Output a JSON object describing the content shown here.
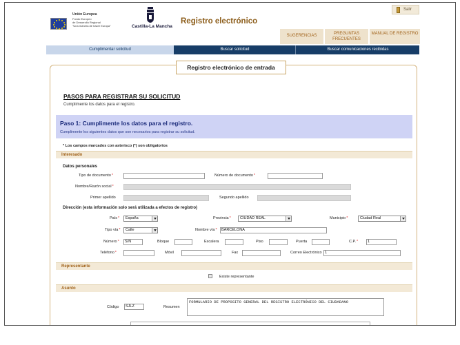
{
  "header": {
    "eu": {
      "line1": "Unión Europea",
      "line2": "Fondo Europeo",
      "line3": "de Desarrollo Regional",
      "line4": "\"Una manera de hacer Europa\""
    },
    "region_name": "Castilla-La Mancha",
    "site_title": "Registro electrónico",
    "exit_label": "Salir",
    "nav": {
      "suggestions": "SUGERENCIAS",
      "faq": "PREGUNTAS FRECUENTES",
      "manual": "MANUAL DE REGISTRO"
    }
  },
  "tabs": {
    "fill": "Cumplimentar solicitud",
    "search": "Buscar solicitud",
    "comms": "Buscar comunicaciones recibidas"
  },
  "main": {
    "title": "Registro electrónico de entrada",
    "steps_heading": "PASOS PARA REGISTRAR SU SOLICITUD",
    "steps_sub": "Cumplimente los datos para el registro.",
    "step1_title": "Paso 1: Cumplimente los datos para el registro.",
    "step1_sub": "Cumplimente los siguientes datos que son necesarios para registrar su solicitud.",
    "required_note": "* Los campos marcados con asterisco (*) son obligatorios"
  },
  "interesado": {
    "section": "Interesado",
    "personal_heading": "Datos personales",
    "labels": {
      "doc_type": "Tipo de documento",
      "doc_number": "Número de documento",
      "name": "Nombre/Razón social",
      "surname1": "Primer apellido",
      "surname2": "Segundo apellido"
    },
    "values": {
      "doc_type": "",
      "doc_number": "",
      "name": "",
      "surname1": "",
      "surname2": ""
    },
    "address_heading": "Dirección (esta información solo será utilizada a efectos de registro)",
    "address_labels": {
      "country": "País",
      "province": "Provincia",
      "municipality": "Municipio",
      "road_type": "Tipo vía",
      "road_name": "Nombre vía",
      "number": "Número",
      "block": "Bloque",
      "stair": "Escalera",
      "floor": "Piso",
      "door": "Puerta",
      "zip": "C.P.",
      "phone": "Teléfono",
      "mobile": "Móvil",
      "fax": "Fax",
      "email": "Correo Electrónico"
    },
    "address_values": {
      "country": "España",
      "province": "CIUDAD REAL",
      "municipality": "Ciudad Real",
      "road_type": "Calle",
      "road_name": "BARCELONA",
      "number": "S/N",
      "block": "",
      "stair": "",
      "floor": "",
      "door": "",
      "zip": "1",
      "phone": "",
      "mobile": "",
      "fax": "",
      "email": "1"
    }
  },
  "representante": {
    "section": "Representante",
    "checkbox_label": "Existe representante"
  },
  "asunto": {
    "section": "Asunto",
    "code_label": "Código",
    "code_value": "SJLZ",
    "summary_label": "Resumen",
    "summary_value": "FORMULARIO DE PROPOSITO GENERAL DEL REGISTRO ELECTRÓNICO DEL CIUDADANO"
  },
  "colors": {
    "title_brown": "#8c5d1a",
    "nav_dark": "#173d67",
    "step_bg": "#cfd3f5",
    "section_bg": "#f3e9d6"
  }
}
